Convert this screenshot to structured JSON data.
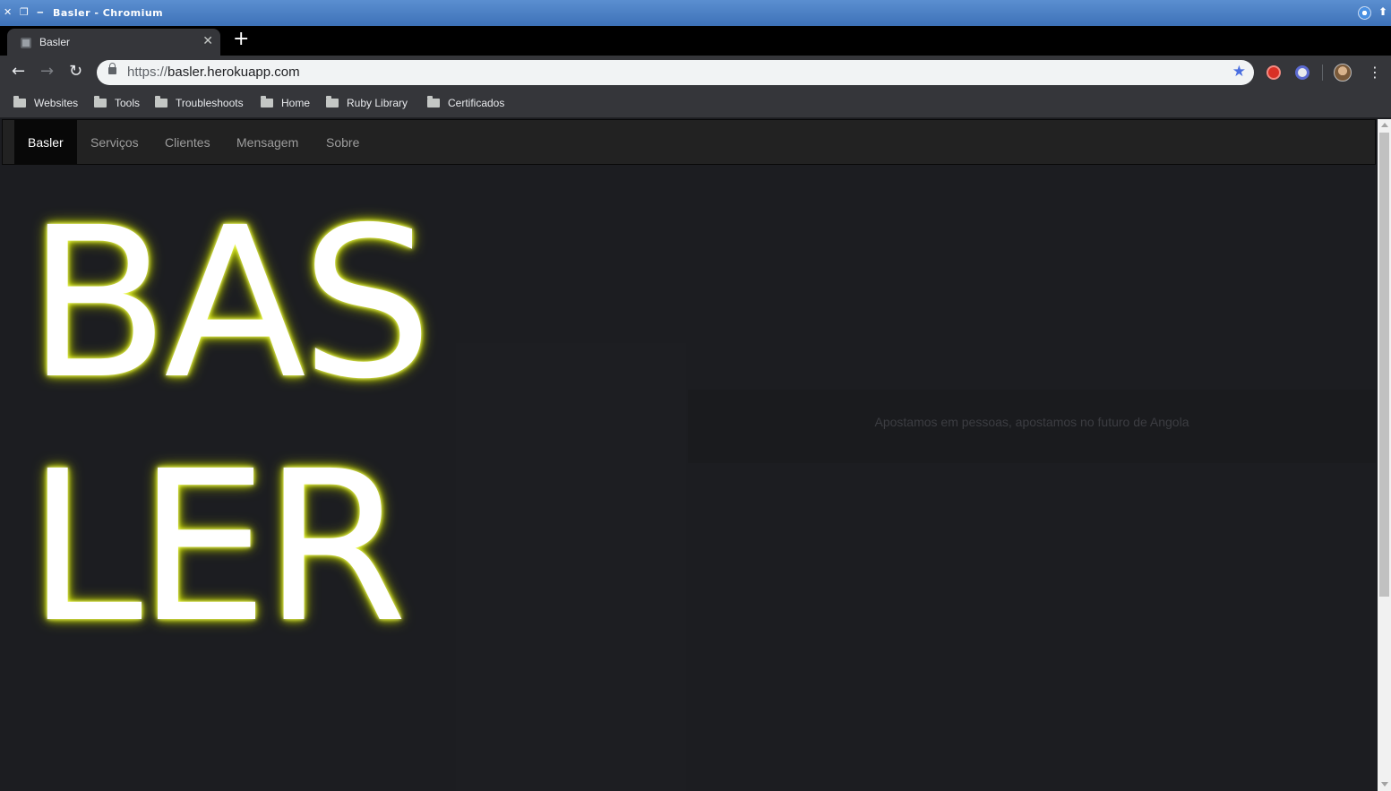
{
  "window": {
    "title": "Basler - Chromium",
    "controls": {
      "close": "✕",
      "restore": "❐",
      "minimize": "‒"
    }
  },
  "tabs": [
    {
      "title": "Basler",
      "close": "✕",
      "active": true
    }
  ],
  "new_tab": "+",
  "toolbar": {
    "back": "←",
    "forward": "→",
    "reload": "↻",
    "url_scheme": "https://",
    "url_host": "basler.herokuapp.com",
    "bookmark_star": "★",
    "menu": "⋮"
  },
  "bookmarks": [
    {
      "label": "Websites",
      "icon": "folder-icon"
    },
    {
      "label": "Tools",
      "icon": "folder-icon"
    },
    {
      "label": "Troubleshoots",
      "icon": "folder-icon"
    },
    {
      "label": "Home",
      "icon": "folder-icon"
    },
    {
      "label": "Ruby Library",
      "icon": "folder-icon"
    },
    {
      "label": "Certificados",
      "icon": "folder-icon"
    }
  ],
  "site_nav": {
    "items": [
      {
        "label": "Basler",
        "active": true
      },
      {
        "label": "Serviços",
        "active": false
      },
      {
        "label": "Clientes",
        "active": false
      },
      {
        "label": "Mensagem",
        "active": false
      },
      {
        "label": "Sobre",
        "active": false
      }
    ]
  },
  "hero": {
    "line1": "BAS",
    "line2": "LER",
    "glow_color": "#d4e800"
  },
  "tagline": "Apostamos em pessoas, apostamos no futuro de Angola",
  "colors": {
    "page_bg": "#1c1d21",
    "navbar_bg": "#222222",
    "chrome_bg": "#35363a",
    "titlebar": "#3d72b8"
  }
}
